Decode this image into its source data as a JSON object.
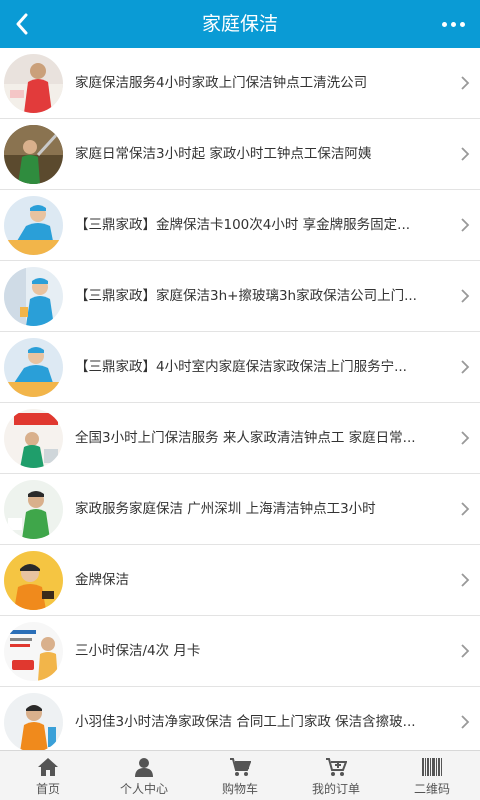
{
  "header": {
    "title": "家庭保洁",
    "back_icon": "chevron-left-icon",
    "more_icon": "more-dots-icon",
    "background": "#0a9bd5"
  },
  "items": [
    {
      "title": "家庭保洁服务4小时家政上门保洁钟点工清洗公司"
    },
    {
      "title": "家庭日常保洁3小时起 家政小时工钟点工保洁阿姨"
    },
    {
      "title": "【三鼎家政】金牌保洁卡100次4小时 享金牌服务固定..."
    },
    {
      "title": "【三鼎家政】家庭保洁3h+擦玻璃3h家政保洁公司上门..."
    },
    {
      "title": "【三鼎家政】4小时室内家庭保洁家政保洁上门服务宁..."
    },
    {
      "title": "全国3小时上门保洁服务 来人家政清洁钟点工 家庭日常..."
    },
    {
      "title": "家政服务家庭保洁 广州深圳 上海清洁钟点工3小时"
    },
    {
      "title": "金牌保洁"
    },
    {
      "title": "三小时保洁/4次 月卡"
    },
    {
      "title": "小羽佳3小时洁净家政保洁 合同工上门家政 保洁含擦玻..."
    }
  ],
  "tabbar": [
    {
      "label": "首页",
      "icon": "home-icon"
    },
    {
      "label": "个人中心",
      "icon": "user-icon"
    },
    {
      "label": "购物车",
      "icon": "cart-icon"
    },
    {
      "label": "我的订单",
      "icon": "order-cart-icon"
    },
    {
      "label": "二维码",
      "icon": "barcode-icon"
    }
  ]
}
